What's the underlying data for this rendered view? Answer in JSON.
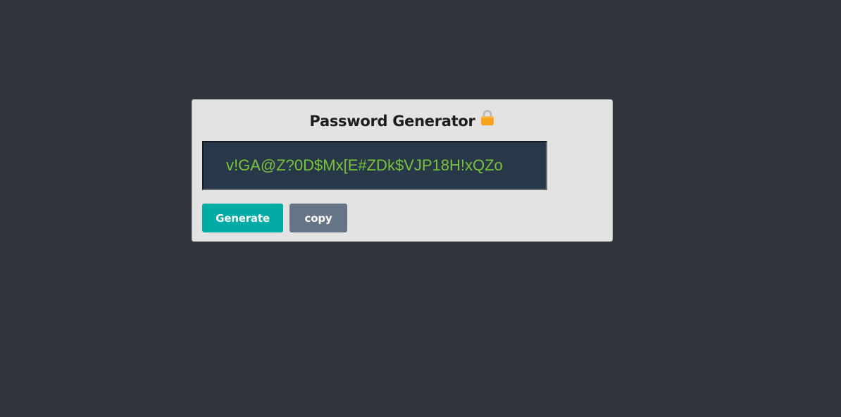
{
  "app": {
    "title": "Password Generator",
    "title_icon": "lock-icon"
  },
  "password": {
    "value": "v!GA@Z?0D$Mx[E#ZDk$VJP18H!xQZo"
  },
  "actions": {
    "generate_label": "Generate",
    "copy_label": "copy"
  },
  "colors": {
    "page_background": "#30343c",
    "card_background": "#e3e3e3",
    "password_background": "#283848",
    "password_text": "#79c23b",
    "generate_button": "#02aba3",
    "copy_button": "#667586",
    "lock_icon": "#f7a21b"
  }
}
